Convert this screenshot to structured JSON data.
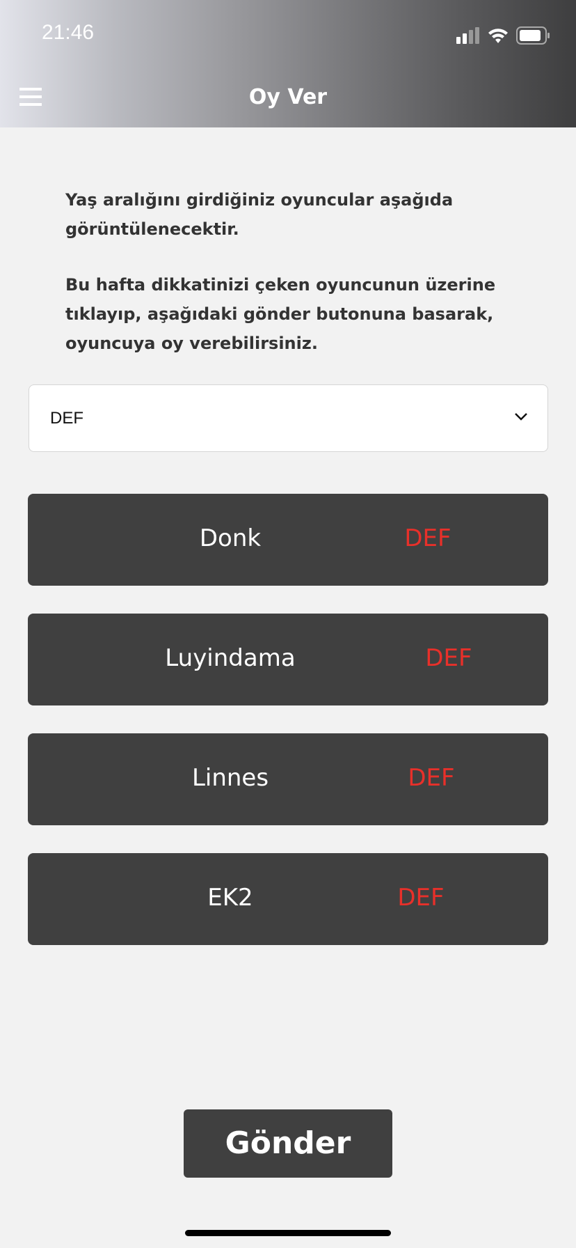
{
  "status_bar": {
    "time": "21:46"
  },
  "header": {
    "title": "Oy Ver"
  },
  "intro": {
    "p1": "Yaş aralığını girdiğiniz oyuncular aşağıda görüntülenecektir.",
    "p2": "Bu hafta dikkatinizi çeken oyuncunun üzerine tıklayıp, aşağıdaki gönder butonuna basarak, oyuncuya oy verebilirsiniz."
  },
  "position_select": {
    "value": "DEF"
  },
  "players": [
    {
      "name": "Donk",
      "position": "DEF"
    },
    {
      "name": "Luyindama",
      "position": "DEF"
    },
    {
      "name": "Linnes",
      "position": "DEF"
    },
    {
      "name": "EK2",
      "position": "DEF"
    }
  ],
  "submit": {
    "label": "Gönder"
  },
  "colors": {
    "accent": "#e8302a",
    "card": "#404040"
  }
}
